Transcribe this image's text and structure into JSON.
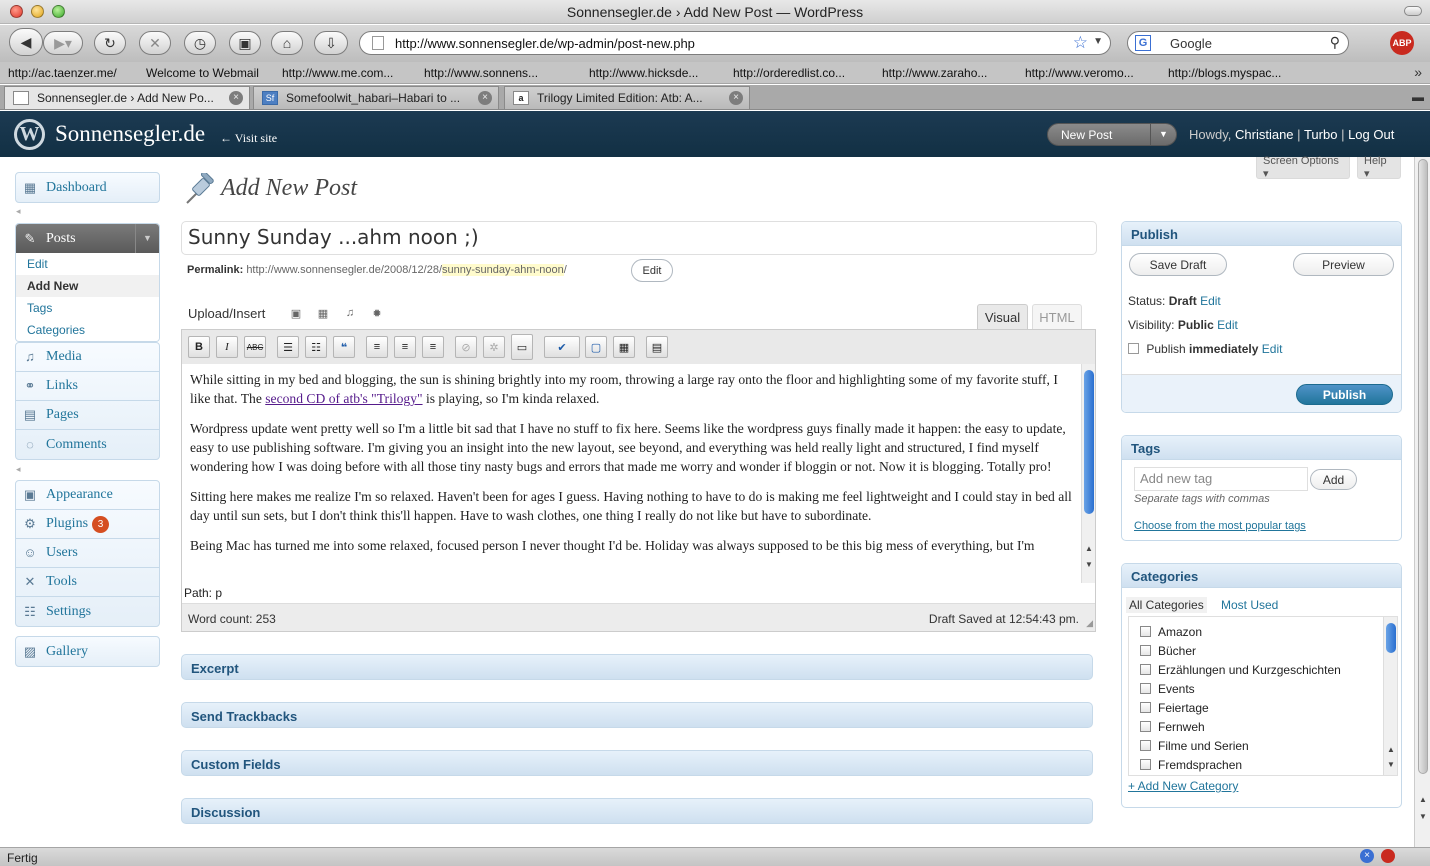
{
  "window": {
    "title": "Sonnensegler.de › Add New Post — WordPress"
  },
  "browser": {
    "url": "http://www.sonnensegler.de/wp-admin/post-new.php",
    "search_placeholder": "Google",
    "search_engine_icon": "G",
    "abp_label": "ABP",
    "bookmarks": [
      "http://ac.taenzer.me/",
      "Welcome to Webmail",
      "http://www.me.com...",
      "http://www.sonnens...",
      "http://www.hicksde...",
      "http://orderedlist.co...",
      "http://www.zaraho...",
      "http://www.veromo...",
      "http://blogs.myspac..."
    ],
    "tabs": [
      {
        "label": "Sonnensegler.de › Add New Po...",
        "favicon": ""
      },
      {
        "label": "Somefoolwit_habari–Habari to ...",
        "favicon": "Sf"
      },
      {
        "label": "Trilogy Limited Edition: Atb: A...",
        "favicon": "a"
      }
    ],
    "status": "Fertig"
  },
  "wp_header": {
    "logo_letter": "W",
    "site_name": "Sonnensegler.de",
    "visit_site": "← Visit site",
    "favorite_action": "New Post",
    "howdy": "Howdy,",
    "user": "Christiane",
    "sep": "|",
    "turbo": "Turbo",
    "logout": "Log Out"
  },
  "top_buttons": {
    "screen_options": "Screen Options ▾",
    "help": "Help ▾"
  },
  "menu": {
    "dashboard": "Dashboard",
    "posts": "Posts",
    "posts_sub": [
      "Edit",
      "Add New",
      "Tags",
      "Categories"
    ],
    "group1": [
      "Media",
      "Links",
      "Pages",
      "Comments"
    ],
    "group2": [
      "Appearance",
      "Plugins",
      "Users",
      "Tools",
      "Settings"
    ],
    "plugins_badge": "3",
    "gallery": "Gallery"
  },
  "page": {
    "title": "Add New Post"
  },
  "post": {
    "title": "Sunny Sunday ...ahm noon ;)",
    "permalink_label": "Permalink:",
    "permalink_base": "http://www.sonnensegler.de/2008/12/28/",
    "permalink_slug": "sunny-sunday-ahm-noon",
    "permalink_end": "/",
    "permalink_edit": "Edit"
  },
  "editor": {
    "upload_insert": "Upload/Insert",
    "tab_visual": "Visual",
    "tab_html": "HTML",
    "toolbar": {
      "bold": "B",
      "italic": "I",
      "strike": "ABC",
      "ul": "☰",
      "ol": "☷",
      "quote": "❝",
      "align_left": "≡",
      "align_center": "≡",
      "align_right": "≡",
      "link": "⊘",
      "unlink": "✲",
      "more": "▭",
      "spell": "✔",
      "fullscreen": "▢",
      "kitchen": "▦",
      "paste": "▤"
    },
    "p1_a": "While sitting in my bed and blogging, the sun is shining brightly into my room, throwing a large ray onto the floor and highlighting some of my favorite stuff, I like that. The ",
    "p1_link": "second CD of atb's \"Trilogy\"",
    "p1_b": " is playing, so I'm kinda relaxed.",
    "p2": "Wordpress update went pretty well so I'm a little bit sad that I have no stuff to fix here. Seems like the wordpress guys finally made it happen: the easy to update, easy to use publishing software. I'm giving you an insight into the new layout, see beyond, and everything was held really light and structured, I find myself wondering how I was doing before with all those tiny nasty bugs and errors that made me worry and wonder if bloggin or not. Now it is blogging. Totally pro!",
    "p3": "Sitting here makes me realize I'm so relaxed. Haven't been for ages I guess. Having nothing to have to do is making me feel lightweight and I could stay in bed all day until sun sets, but I don't think this'll happen. Have to wash clothes, one thing I really do not like but have to subordinate.",
    "p4": "Being Mac has turned me into some relaxed, focused person I never thought I'd be. Holiday was always supposed to be this big mess of everything, but I'm",
    "path": "Path: p",
    "word_count": "Word count: 253",
    "draft_saved": "Draft Saved at 12:54:43 pm."
  },
  "postboxes": [
    "Excerpt",
    "Send Trackbacks",
    "Custom Fields",
    "Discussion"
  ],
  "publish": {
    "heading": "Publish",
    "save_draft": "Save Draft",
    "preview": "Preview",
    "status_label": "Status:",
    "status_value": "Draft",
    "visibility_label": "Visibility:",
    "visibility_value": "Public",
    "schedule_label": "Publish",
    "schedule_value": "immediately",
    "edit": "Edit",
    "publish_button": "Publish"
  },
  "tags": {
    "heading": "Tags",
    "placeholder": "Add new tag",
    "add": "Add",
    "hint": "Separate tags with commas",
    "popular": "Choose from the most popular tags"
  },
  "categories": {
    "heading": "Categories",
    "tab_all": "All Categories",
    "tab_used": "Most Used",
    "items": [
      "Amazon",
      "Bücher",
      "Erzählungen und Kurzgeschichten",
      "Events",
      "Feiertage",
      "Fernweh",
      "Filme und Serien",
      "Fremdsprachen"
    ],
    "add_new": "+ Add New Category"
  }
}
